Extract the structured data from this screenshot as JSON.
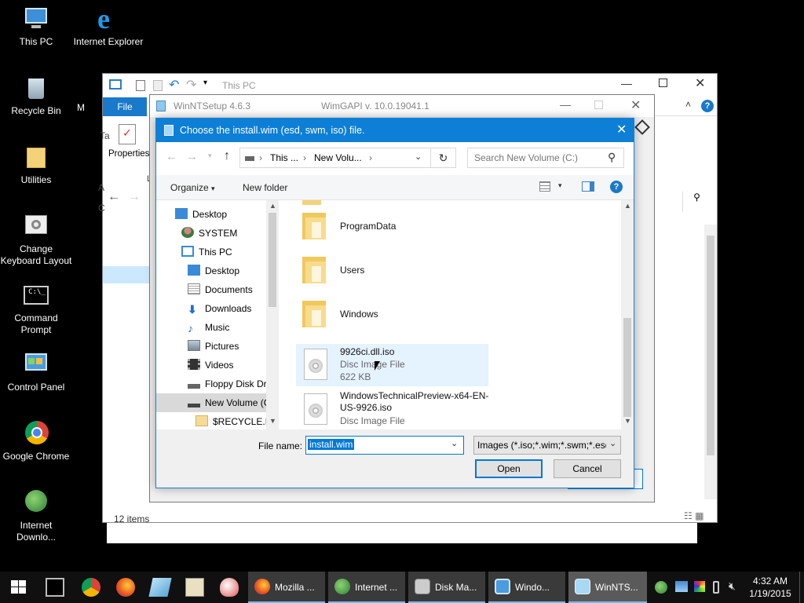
{
  "desktop": {
    "icons": [
      {
        "label": "This PC"
      },
      {
        "label": "Internet Explorer"
      },
      {
        "label": "Recycle Bin"
      },
      {
        "label": "Utilities"
      },
      {
        "label": "Change Keyboard Layout"
      },
      {
        "label": "Command Prompt"
      },
      {
        "label": "Control Panel"
      },
      {
        "label": "Google Chrome"
      },
      {
        "label": "Internet Downlo..."
      }
    ],
    "partial_label_m": "M"
  },
  "explorer": {
    "title": "This PC",
    "file_tab": "File",
    "properties_label": "Properties",
    "status": "12 items",
    "frag_ta": "Ta",
    "frag_a": "A",
    "frag_c": "C",
    "frag_l": "L"
  },
  "winntsetup": {
    "title": "WinNTSetup 4.6.3",
    "subtitle": "WimGAPI v. 10.0.19041.1"
  },
  "dialog": {
    "title": "Choose the install.wim (esd, swm, iso) file.",
    "breadcrumb": [
      "This ...",
      "New Volu..."
    ],
    "search_placeholder": "Search New Volume (C:)",
    "organize_label": "Organize",
    "new_folder_label": "New folder",
    "tree": [
      {
        "label": "Desktop"
      },
      {
        "label": "SYSTEM"
      },
      {
        "label": "This PC"
      },
      {
        "label": "Desktop"
      },
      {
        "label": "Documents"
      },
      {
        "label": "Downloads"
      },
      {
        "label": "Music"
      },
      {
        "label": "Pictures"
      },
      {
        "label": "Videos"
      },
      {
        "label": "Floppy Disk Dri"
      },
      {
        "label": "New Volume (C"
      },
      {
        "label": "$RECYCLE.BII"
      }
    ],
    "files": [
      {
        "name": "ProgramData",
        "type": "folder"
      },
      {
        "name": "Users",
        "type": "folder"
      },
      {
        "name": "Windows",
        "type": "folder"
      },
      {
        "name": "9926ci.dll.iso",
        "desc": "Disc Image File",
        "size": "622 KB",
        "type": "disc"
      },
      {
        "name": "WindowsTechnicalPreview-x64-EN-US-9926.iso",
        "desc": "Disc Image File",
        "type": "disc"
      }
    ],
    "filename_label": "File name:",
    "filename_value": "install.wim",
    "filter_value": "Images (*.iso;*.wim;*.swm;*.esd",
    "open_label": "Open",
    "cancel_label": "Cancel"
  },
  "taskbar": {
    "buttons": [
      {
        "label": "Mozilla ..."
      },
      {
        "label": "Internet ..."
      },
      {
        "label": "Disk Ma..."
      },
      {
        "label": "Windo..."
      },
      {
        "label": "WinNTS..."
      }
    ],
    "time": "4:32 AM",
    "date": "1/19/2015"
  },
  "colors": {
    "accent": "#0d7fd6",
    "selection": "#cce8ff",
    "hover": "#e5f3ff"
  }
}
